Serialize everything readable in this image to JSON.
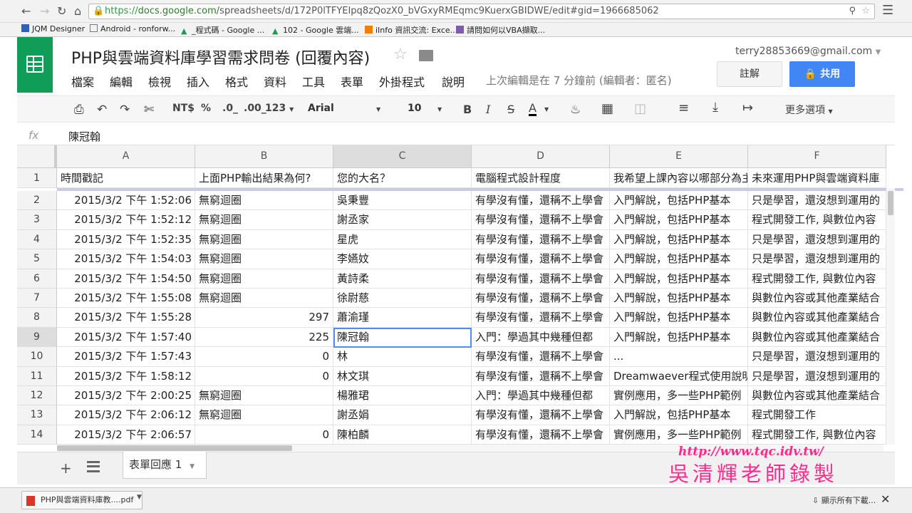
{
  "browser": {
    "url_prefix": "https://",
    "url_host": "docs.google.com",
    "url_path": "/spreadsheets/d/172P0lTFYEIpq8zQozX0_bVGxyRMEqmc9KuerxGBIDWE/edit#gid=1966685062",
    "bookmarks": [
      "JQM Designer",
      "Android - ronforw...",
      "_程式碼 - Google ...",
      "102 - Google 雲端...",
      "iInfo 資訊交流: Exce...",
      "請問如何以VBA擷取..."
    ]
  },
  "doc": {
    "title": "PHP與雲端資料庫學習需求問卷 (回覆內容)",
    "account": "terry28853669@gmail.com",
    "comment_label": "註解",
    "share_label": "共用",
    "last_edit": "上次編輯是在 7 分鐘前 (編輯者：匿名)"
  },
  "menu": [
    "檔案",
    "編輯",
    "檢視",
    "插入",
    "格式",
    "資料",
    "工具",
    "表單",
    "外掛程式",
    "說明"
  ],
  "toolbar": {
    "currency": "NT$",
    "percent": "%",
    "dec_less": ".0_",
    "dec_more": ".00_",
    "number_format": "123",
    "font": "Arial",
    "font_size": "10",
    "bold": "B",
    "italic": "I",
    "strike": "S",
    "text_color": "A",
    "more": "更多選項"
  },
  "formula_bar": {
    "fx": "fx",
    "value": "陳冠翰"
  },
  "columns": [
    "A",
    "B",
    "C",
    "D",
    "E",
    "F"
  ],
  "header_row": {
    "num": "1",
    "cells": [
      "時間戳記",
      "上面PHP輸出結果為何?",
      "您的大名？",
      "電腦程式設計程度",
      "我希望上課內容以哪部分為主",
      "未來運用PHP與雲端資料庫"
    ]
  },
  "rows": [
    {
      "num": "2",
      "a": "2015/3/2 下午 1:52:06",
      "b": "無窮迴圈",
      "c": "吳秉豐",
      "d": "有學沒有懂，還稱不上學會",
      "e": "入門解說，包括PHP基本",
      "f": "只是學習，還沒想到運用的"
    },
    {
      "num": "3",
      "a": "2015/3/2 下午 1:52:12",
      "b": "無窮迴圈",
      "c": "謝丞家",
      "d": "有學沒有懂，還稱不上學會",
      "e": "入門解說，包括PHP基本",
      "f": "程式開發工作, 與數位內容"
    },
    {
      "num": "4",
      "a": "2015/3/2 下午 1:52:35",
      "b": "無窮迴圈",
      "c": "星虎",
      "d": "有學沒有懂，還稱不上學會",
      "e": "入門解說，包括PHP基本",
      "f": "只是學習，還沒想到運用的"
    },
    {
      "num": "5",
      "a": "2015/3/2 下午 1:54:03",
      "b": "無窮迴圈",
      "c": "李嬿妏",
      "d": "有學沒有懂，還稱不上學會",
      "e": "入門解說，包括PHP基本",
      "f": "只是學習，還沒想到運用的"
    },
    {
      "num": "6",
      "a": "2015/3/2 下午 1:54:50",
      "b": "無窮迴圈",
      "c": "黃詩柔",
      "d": "有學沒有懂，還稱不上學會",
      "e": "入門解說，包括PHP基本",
      "f": "程式開發工作, 與數位內容"
    },
    {
      "num": "7",
      "a": "2015/3/2 下午 1:55:08",
      "b": "無窮迴圈",
      "c": "徐尉慈",
      "d": "有學沒有懂，還稱不上學會",
      "e": "入門解說，包括PHP基本",
      "f": "與數位內容或其他產業結合"
    },
    {
      "num": "8",
      "a": "2015/3/2 下午 1:55:28",
      "b": "297",
      "c": "蕭渝瑾",
      "d": "有學沒有懂，還稱不上學會",
      "e": "入門解說，包括PHP基本",
      "f": "與數位內容或其他產業結合"
    },
    {
      "num": "9",
      "a": "2015/3/2 下午 1:57:40",
      "b": "225",
      "c": "陳冠翰",
      "d": "入門：學過其中幾種但都",
      "e": "入門解說，包括PHP基本",
      "f": "與數位內容或其他產業結合"
    },
    {
      "num": "10",
      "a": "2015/3/2 下午 1:57:43",
      "b": "0",
      "c": "林",
      "d": "有學沒有懂，還稱不上學會",
      "e": "...",
      "f": "只是學習，還沒想到運用的"
    },
    {
      "num": "11",
      "a": "2015/3/2 下午 1:58:12",
      "b": "0",
      "c": "林文琪",
      "d": "有學沒有懂，還稱不上學會",
      "e": "Dreamwaever程式使用說明",
      "f": "只是學習，還沒想到運用的"
    },
    {
      "num": "12",
      "a": "2015/3/2 下午 2:00:25",
      "b": "無窮迴圈",
      "c": "楊雅珺",
      "d": "入門：學過其中幾種但都",
      "e": "實例應用，多一些PHP範例",
      "f": "與數位內容或其他產業結合"
    },
    {
      "num": "13",
      "a": "2015/3/2 下午 2:06:12",
      "b": "無窮迴圈",
      "c": "謝丞娟",
      "d": "有學沒有懂，還稱不上學會",
      "e": "入門解說，包括PHP基本",
      "f": "程式開發工作"
    },
    {
      "num": "14",
      "a": "2015/3/2 下午 2:06:57",
      "b": "0",
      "c": "陳柏麟",
      "d": "有學沒有懂，還稱不上學會",
      "e": "實例應用，多一些PHP範例",
      "f": "程式開發工作, 與數位內容"
    }
  ],
  "sheet_tab": "表單回應 1",
  "watermark": {
    "url": "http://www.tqc.idv.tw/",
    "signature": "吳清輝老師錄製"
  },
  "download": {
    "file": "PHP與雲端資料庫教....pdf",
    "show_all": "顯示所有下載..."
  },
  "colors": {
    "sheets_green": "#0f9d58",
    "share_blue": "#4285f4",
    "selection_blue": "#4d8ef6",
    "watermark_pink": "#ff2a8a"
  }
}
